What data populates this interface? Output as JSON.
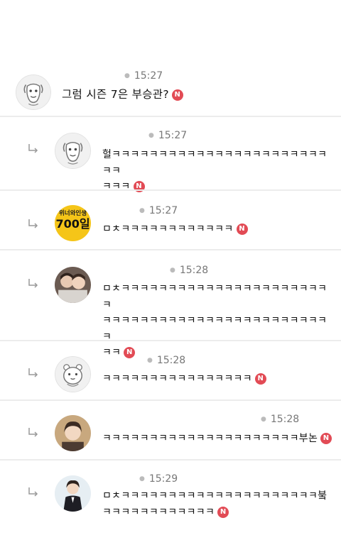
{
  "badge_label": "N",
  "colors": {
    "badge": "#e24b55",
    "divider": "#ececec",
    "time": "#777777"
  },
  "comments": [
    {
      "time": "15:27",
      "text": "그럼 시즌 7은 부승관?",
      "avatar": "dog-sketch"
    },
    {
      "time": "15:27",
      "text": "헐ㅋㅋㅋㅋㅋㅋㅋㅋㅋㅋㅋㅋㅋㅋㅋㅋㅋㅋㅋㅋㅋㅋㅋㅋㅋ\nㅋㅋㅋ",
      "avatar": "dog-sketch"
    },
    {
      "time": "15:27",
      "text": "ㅁㅊㅋㅋㅋㅋㅋㅋㅋㅋㅋㅋㅋㅋ",
      "avatar": "winner-700-logo",
      "logo_text_small": "위너와인생",
      "logo_text_big": "700일"
    },
    {
      "time": "15:28",
      "text": "ㅁㅊㅋㅋㅋㅋㅋㅋㅋㅋㅋㅋㅋㅋㅋㅋㅋㅋㅋㅋㅋㅋㅋㅋㅋ\nㅋㅋㅋㅋㅋㅋㅋㅋㅋㅋㅋㅋㅋㅋㅋㅋㅋㅋㅋㅋㅋㅋㅋㅋㅋ\nㅋㅋ",
      "avatar": "photo-two-people"
    },
    {
      "time": "15:28",
      "text": "ㅋㅋㅋㅋㅋㅋㅋㅋㅋㅋㅋㅋㅋㅋㅋㅋ",
      "avatar": "character-sketch"
    },
    {
      "time": "15:28",
      "text": "ㅋㅋㅋㅋㅋㅋㅋㅋㅋㅋㅋㅋㅋㅋㅋㅋㅋㅋㅋㅋㅋ부논",
      "avatar": "photo-person"
    },
    {
      "time": "15:29",
      "text": "ㅁㅊㅋㅋㅋㅋㅋㅋㅋㅋㅋㅋㅋㅋㅋㅋㅋㅋㅋㅋㅋㅋㅋ붘\nㅋㅋㅋㅋㅋㅋㅋㅋㅋㅋㅋㅋ",
      "avatar": "photo-person-suit"
    }
  ]
}
